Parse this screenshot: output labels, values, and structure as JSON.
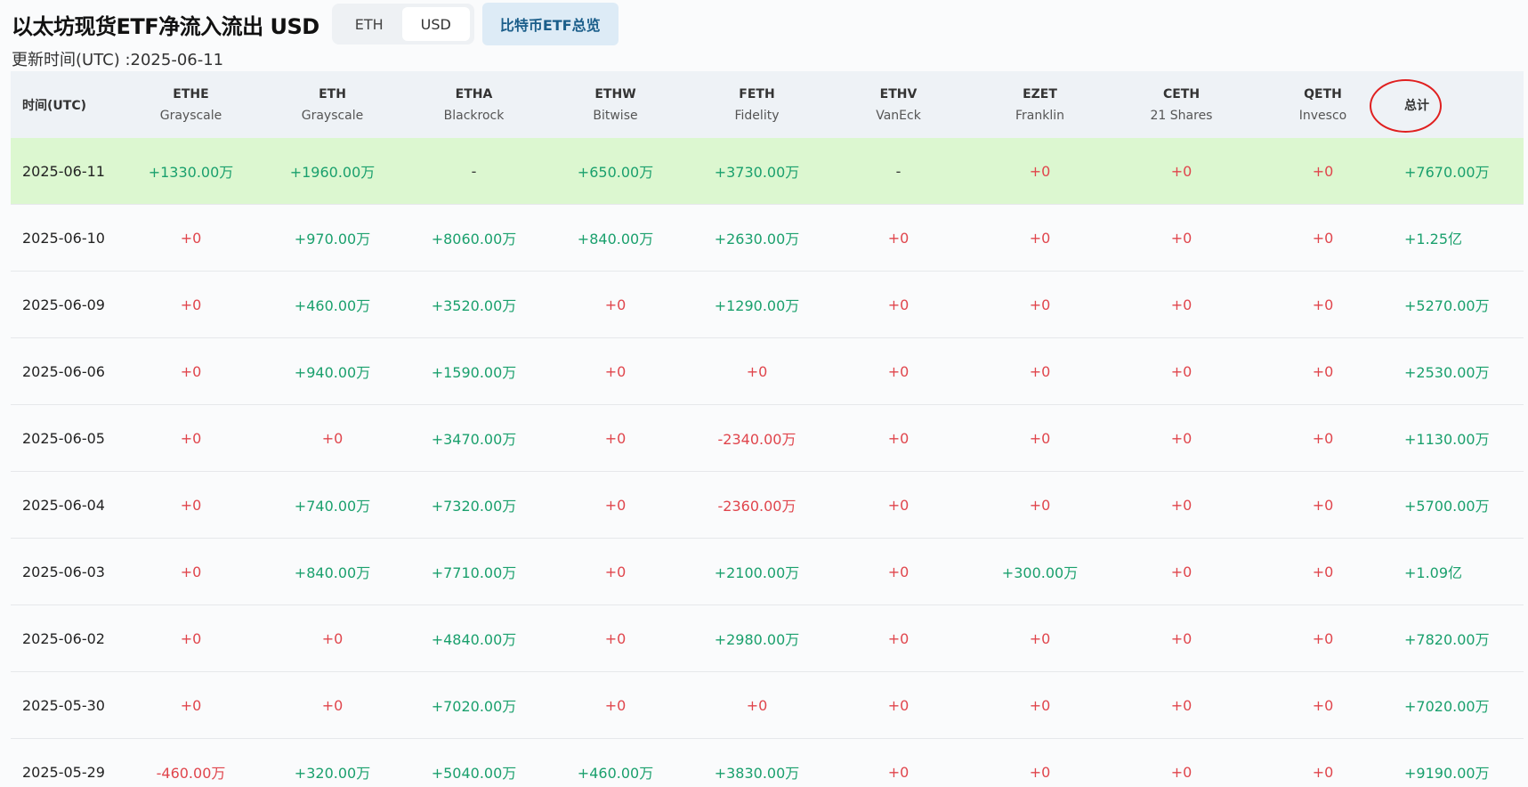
{
  "header": {
    "title": "以太坊现货ETF净流入流出 USD",
    "toggle": [
      {
        "label": "ETH",
        "active": false
      },
      {
        "label": "USD",
        "active": true
      }
    ],
    "btc_overview": "比特币ETF总览"
  },
  "updated": "更新时间(UTC) :2025-06-11",
  "table": {
    "date_header": "时间(UTC)",
    "total_header": "总计",
    "funds": [
      {
        "ticker": "ETHE",
        "issuer": "Grayscale"
      },
      {
        "ticker": "ETH",
        "issuer": "Grayscale"
      },
      {
        "ticker": "ETHA",
        "issuer": "Blackrock"
      },
      {
        "ticker": "ETHW",
        "issuer": "Bitwise"
      },
      {
        "ticker": "FETH",
        "issuer": "Fidelity"
      },
      {
        "ticker": "ETHV",
        "issuer": "VanEck"
      },
      {
        "ticker": "EZET",
        "issuer": "Franklin"
      },
      {
        "ticker": "CETH",
        "issuer": "21 Shares"
      },
      {
        "ticker": "QETH",
        "issuer": "Invesco"
      }
    ],
    "rows": [
      {
        "date": "2025-06-11",
        "values": [
          "+1330.00万",
          "+1960.00万",
          "-",
          "+650.00万",
          "+3730.00万",
          "-",
          "+0",
          "+0",
          "+0"
        ],
        "total": "+7670.00万"
      },
      {
        "date": "2025-06-10",
        "values": [
          "+0",
          "+970.00万",
          "+8060.00万",
          "+840.00万",
          "+2630.00万",
          "+0",
          "+0",
          "+0",
          "+0"
        ],
        "total": "+1.25亿"
      },
      {
        "date": "2025-06-09",
        "values": [
          "+0",
          "+460.00万",
          "+3520.00万",
          "+0",
          "+1290.00万",
          "+0",
          "+0",
          "+0",
          "+0"
        ],
        "total": "+5270.00万"
      },
      {
        "date": "2025-06-06",
        "values": [
          "+0",
          "+940.00万",
          "+1590.00万",
          "+0",
          "+0",
          "+0",
          "+0",
          "+0",
          "+0"
        ],
        "total": "+2530.00万"
      },
      {
        "date": "2025-06-05",
        "values": [
          "+0",
          "+0",
          "+3470.00万",
          "+0",
          "-2340.00万",
          "+0",
          "+0",
          "+0",
          "+0"
        ],
        "total": "+1130.00万"
      },
      {
        "date": "2025-06-04",
        "values": [
          "+0",
          "+740.00万",
          "+7320.00万",
          "+0",
          "-2360.00万",
          "+0",
          "+0",
          "+0",
          "+0"
        ],
        "total": "+5700.00万"
      },
      {
        "date": "2025-06-03",
        "values": [
          "+0",
          "+840.00万",
          "+7710.00万",
          "+0",
          "+2100.00万",
          "+0",
          "+300.00万",
          "+0",
          "+0"
        ],
        "total": "+1.09亿"
      },
      {
        "date": "2025-06-02",
        "values": [
          "+0",
          "+0",
          "+4840.00万",
          "+0",
          "+2980.00万",
          "+0",
          "+0",
          "+0",
          "+0"
        ],
        "total": "+7820.00万"
      },
      {
        "date": "2025-05-30",
        "values": [
          "+0",
          "+0",
          "+7020.00万",
          "+0",
          "+0",
          "+0",
          "+0",
          "+0",
          "+0"
        ],
        "total": "+7020.00万"
      },
      {
        "date": "2025-05-29",
        "values": [
          "-460.00万",
          "+320.00万",
          "+5040.00万",
          "+460.00万",
          "+3830.00万",
          "+0",
          "+0",
          "+0",
          "+0"
        ],
        "total": "+9190.00万"
      }
    ]
  },
  "colors": {
    "positive": "#1aa06d",
    "negative": "#e0454c",
    "highlight_row": "#dcf7d0",
    "annotation_circle": "#e02020"
  }
}
